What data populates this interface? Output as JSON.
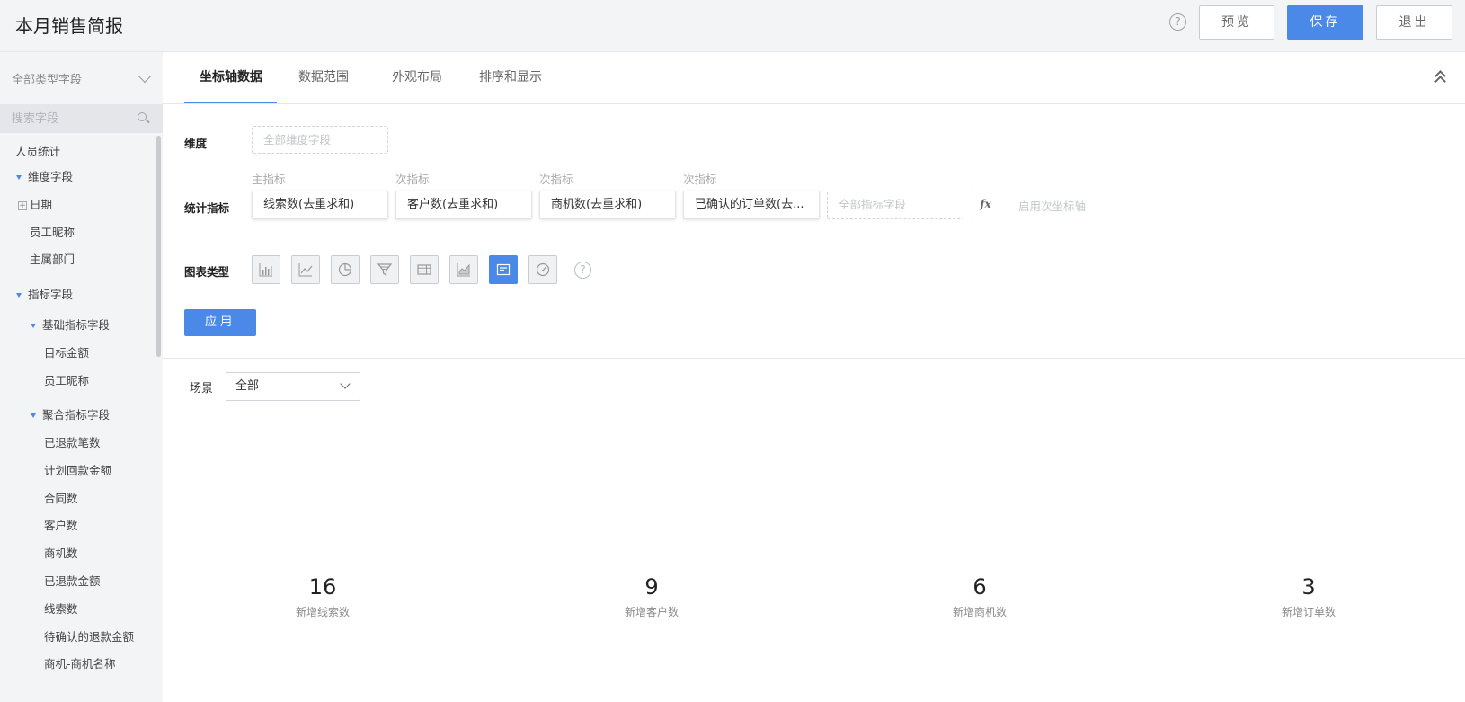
{
  "header": {
    "title": "本月销售简报",
    "help_glyph": "?",
    "preview_label": "预览",
    "save_label": "保存",
    "quit_label": "退出"
  },
  "sidebar": {
    "type_filter": "全部类型字段",
    "search_placeholder": "搜索字段",
    "tree": {
      "root": "人员统计",
      "dimension_group": "维度字段",
      "date": "日期",
      "employee_nickname": "员工昵称",
      "owner_department": "主属部门",
      "metric_group": "指标字段",
      "basic_group": "基础指标字段",
      "target_amount": "目标金额",
      "employee_nickname_2": "员工昵称",
      "aggregate_group": "聚合指标字段",
      "refunded_count": "已退款笔数",
      "planned_payment": "计划回款金额",
      "contract_count": "合同数",
      "customer_count": "客户数",
      "opportunity_count": "商机数",
      "refunded_amount": "已退款金额",
      "lead_count": "线索数",
      "pending_refund_amount": "待确认的退款金额",
      "opportunity_name": "商机-商机名称"
    }
  },
  "tabs": [
    "坐标轴数据",
    "数据范围",
    "外观布局",
    "排序和显示"
  ],
  "config": {
    "dimension_label": "维度",
    "dimension_placeholder": "全部维度字段",
    "metrics_label": "统计指标",
    "metric_heads": [
      "主指标",
      "次指标",
      "次指标",
      "次指标"
    ],
    "metrics": [
      "线索数(去重求和)",
      "客户数(去重求和)",
      "商机数(去重求和)",
      "已确认的订单数(去..."
    ],
    "metric_placeholder": "全部指标字段",
    "fx_label": "fx",
    "secondary_axis": "启用次坐标轴",
    "chart_type_label": "图表类型",
    "chart_type_icons": [
      "bar-chart-icon",
      "line-chart-icon",
      "pie-chart-icon",
      "funnel-chart-icon",
      "table-chart-icon",
      "area-chart-icon",
      "kpi-card-icon",
      "gauge-chart-icon"
    ],
    "chart_type_help": "?",
    "apply_label": "应用"
  },
  "preview": {
    "scene_label": "场景",
    "scene_value": "全部",
    "kpis": [
      {
        "value": "16",
        "caption": "新增线索数"
      },
      {
        "value": "9",
        "caption": "新增客户数"
      },
      {
        "value": "6",
        "caption": "新增商机数"
      },
      {
        "value": "3",
        "caption": "新增订单数"
      }
    ]
  },
  "colors": {
    "accent": "#4a89e8",
    "sidebar_bg": "#f3f4f6"
  }
}
